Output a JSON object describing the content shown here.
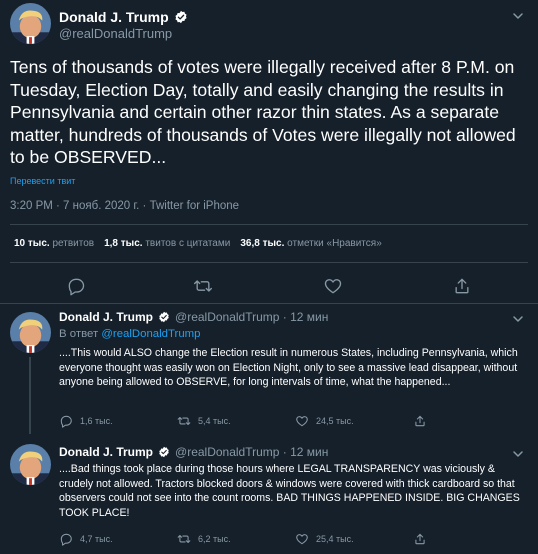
{
  "main_tweet": {
    "display_name": "Donald J. Trump",
    "handle": "@realDonaldTrump",
    "text": "Tens of thousands of votes were illegally received after 8 P.M. on Tuesday, Election Day, totally and easily changing the results in Pennsylvania and certain other razor thin states. As a separate matter, hundreds of thousands of Votes were illegally not allowed to be OBSERVED...",
    "translate_label": "Перевести твит",
    "timestamp": "3:20 PM · 7 нояб. 2020 г. · Twitter for iPhone",
    "stats": {
      "retweets_value": "10 тыс.",
      "retweets_label": "ретвитов",
      "quotes_value": "1,8 тыс.",
      "quotes_label": "твитов с цитатами",
      "likes_value": "36,8 тыс.",
      "likes_label": "отметки «Нравится»"
    }
  },
  "replies": [
    {
      "display_name": "Donald J. Trump",
      "handle_time": "@realDonaldTrump · 12 мин",
      "in_reply_prefix": "В ответ",
      "in_reply_mention": "@realDonaldTrump",
      "text": "....This would ALSO change the Election result in numerous States, including Pennsylvania, which everyone thought was easily won on Election Night, only to see a massive lead disappear, without anyone being allowed to OBSERVE, for long intervals of time, what the happened...",
      "reply_count": "1,6 тыс.",
      "retweet_count": "5,4 тыс.",
      "like_count": "24,5 тыс."
    },
    {
      "display_name": "Donald J. Trump",
      "handle_time": "@realDonaldTrump · 12 мин",
      "text": "....Bad things took place during those hours where LEGAL TRANSPARENCY was viciously & crudely not allowed. Tractors blocked doors & windows were covered with thick cardboard so that observers could not see into the count rooms. BAD THINGS HAPPENED INSIDE. BIG CHANGES TOOK PLACE!",
      "reply_count": "4,7 тыс.",
      "retweet_count": "6,2 тыс.",
      "like_count": "25,4 тыс."
    }
  ],
  "colors": {
    "background": "#15202b",
    "text_primary": "#ffffff",
    "text_secondary": "#8899a6",
    "accent": "#1da1f2",
    "divider": "#38444d"
  },
  "icons": {
    "avatar": "profile-photo",
    "verified": "verified-badge-icon",
    "caret": "chevron-down-icon",
    "reply": "reply-icon",
    "retweet": "retweet-icon",
    "like": "heart-icon",
    "share": "share-icon"
  }
}
